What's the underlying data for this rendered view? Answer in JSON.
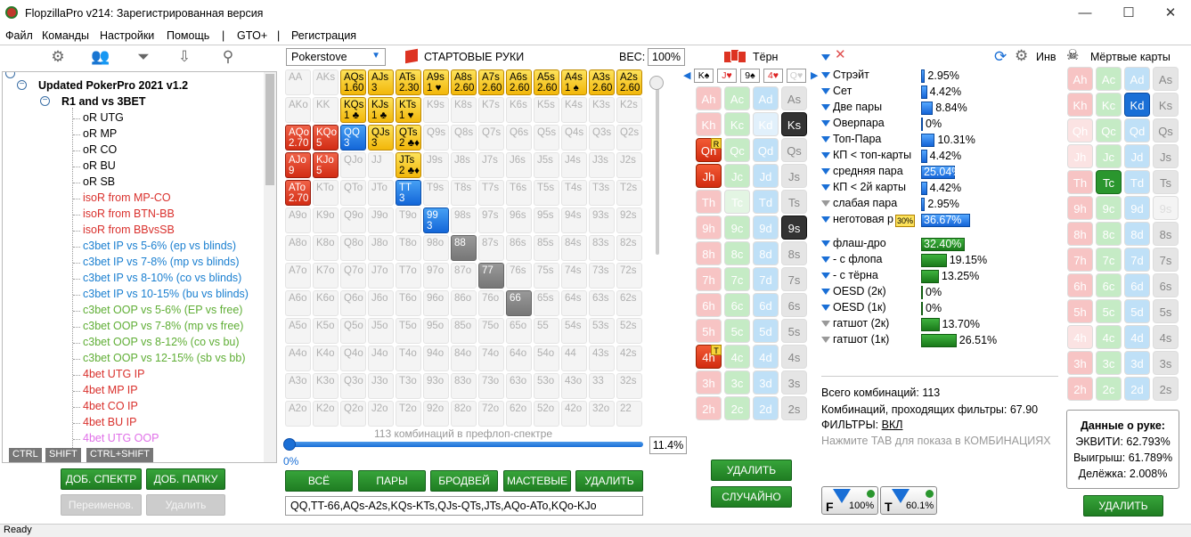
{
  "window": {
    "title": "FlopzillaPro v214: Зарегистрированная версия",
    "minimize": "—",
    "maximize": "☐",
    "close": "✕"
  },
  "menu": [
    "Файл",
    "Команды",
    "Настройки",
    "Помощь",
    "|",
    "GTO+",
    "|",
    "Регистрация"
  ],
  "tree": {
    "root": "Updated PokerPro 2021 v1.2",
    "folder": "R1 and vs 3BET",
    "items": [
      {
        "label": "oR UTG",
        "color": "#000000"
      },
      {
        "label": "oR MP",
        "color": "#000000"
      },
      {
        "label": "oR CO",
        "color": "#000000"
      },
      {
        "label": "oR BU",
        "color": "#000000"
      },
      {
        "label": "oR SB",
        "color": "#000000"
      },
      {
        "label": "isoR from MP-CO",
        "color": "#d9302c"
      },
      {
        "label": "isoR from BTN-BB",
        "color": "#d9302c"
      },
      {
        "label": "isoR from BBvsSB",
        "color": "#d9302c"
      },
      {
        "label": "c3bet IP vs 5-6% (ep vs blinds)",
        "color": "#1a7fd0"
      },
      {
        "label": "c3bet IP vs 7-8% (mp vs blinds)",
        "color": "#1a7fd0"
      },
      {
        "label": "c3bet IP vs 8-10% (co vs blinds)",
        "color": "#1a7fd0"
      },
      {
        "label": "c3bet IP vs 10-15% (bu vs blinds)",
        "color": "#1a7fd0"
      },
      {
        "label": "c3bet OOP vs 5-6% (EP vs free)",
        "color": "#5fae35"
      },
      {
        "label": "c3bet OOP vs 7-8% (mp vs free)",
        "color": "#5fae35"
      },
      {
        "label": "c3bet OOP vs 8-12% (co vs bu)",
        "color": "#5fae35"
      },
      {
        "label": "c3bet OOP vs 12-15% (sb vs bb)",
        "color": "#5fae35"
      },
      {
        "label": "4bet UTG IP",
        "color": "#d9302c"
      },
      {
        "label": "4bet MP IP",
        "color": "#d9302c"
      },
      {
        "label": "4bet CO IP",
        "color": "#d9302c"
      },
      {
        "label": "4bet BU IP",
        "color": "#d9302c"
      },
      {
        "label": "4bet UTG OOP",
        "color": "#e070e8"
      }
    ]
  },
  "keys": [
    "CTRL",
    "SHIFT",
    "CTRL+SHIFT"
  ],
  "left_buttons": {
    "add_range": "ДОБ. СПЕКТР",
    "add_folder": "ДОБ. ПАПКУ",
    "rename": "Переименов.",
    "delete": "Удалить"
  },
  "range": {
    "source": "Pokerstove",
    "header": "СТАРТОВЫЕ РУКИ",
    "weight_label": "ВЕС:",
    "weight": "100%",
    "combos_text": "113 комбинаций в префлоп-спектре",
    "slider_min": "0%",
    "slider_value": "11.4%",
    "buttons": [
      "ВСЁ",
      "ПАРЫ",
      "БРОДВЕЙ",
      "МАСТЕВЫЕ",
      "УДАЛИТЬ"
    ],
    "text": "QQ,TT-66,AQs-A2s,KQs-KTs,QJs-QTs,JTs,AQo-ATo,KQo-KJo",
    "grid": [
      [
        "AA",
        "AKs",
        "AQs",
        "AJs",
        "ATs",
        "A9s",
        "A8s",
        "A7s",
        "A6s",
        "A5s",
        "A4s",
        "A3s",
        "A2s"
      ],
      [
        "AKo",
        "KK",
        "KQs",
        "KJs",
        "KTs",
        "K9s",
        "K8s",
        "K7s",
        "K6s",
        "K5s",
        "K4s",
        "K3s",
        "K2s"
      ],
      [
        "AQo",
        "KQo",
        "QQ",
        "QJs",
        "QTs",
        "Q9s",
        "Q8s",
        "Q7s",
        "Q6s",
        "Q5s",
        "Q4s",
        "Q3s",
        "Q2s"
      ],
      [
        "AJo",
        "KJo",
        "QJo",
        "JJ",
        "JTs",
        "J9s",
        "J8s",
        "J7s",
        "J6s",
        "J5s",
        "J4s",
        "J3s",
        "J2s"
      ],
      [
        "ATo",
        "KTo",
        "QTo",
        "JTo",
        "TT",
        "T9s",
        "T8s",
        "T7s",
        "T6s",
        "T5s",
        "T4s",
        "T3s",
        "T2s"
      ],
      [
        "A9o",
        "K9o",
        "Q9o",
        "J9o",
        "T9o",
        "99",
        "98s",
        "97s",
        "96s",
        "95s",
        "94s",
        "93s",
        "92s"
      ],
      [
        "A8o",
        "K8o",
        "Q8o",
        "J8o",
        "T8o",
        "98o",
        "88",
        "87s",
        "86s",
        "85s",
        "84s",
        "83s",
        "82s"
      ],
      [
        "A7o",
        "K7o",
        "Q7o",
        "J7o",
        "T7o",
        "97o",
        "87o",
        "77",
        "76s",
        "75s",
        "74s",
        "73s",
        "72s"
      ],
      [
        "A6o",
        "K6o",
        "Q6o",
        "J6o",
        "T6o",
        "96o",
        "86o",
        "76o",
        "66",
        "65s",
        "64s",
        "63s",
        "62s"
      ],
      [
        "A5o",
        "K5o",
        "Q5o",
        "J5o",
        "T5o",
        "95o",
        "85o",
        "75o",
        "65o",
        "55",
        "54s",
        "53s",
        "52s"
      ],
      [
        "A4o",
        "K4o",
        "Q4o",
        "J4o",
        "T4o",
        "94o",
        "84o",
        "74o",
        "64o",
        "54o",
        "44",
        "43s",
        "42s"
      ],
      [
        "A3o",
        "K3o",
        "Q3o",
        "J3o",
        "T3o",
        "93o",
        "83o",
        "73o",
        "63o",
        "53o",
        "43o",
        "33",
        "32s"
      ],
      [
        "A2o",
        "K2o",
        "Q2o",
        "J2o",
        "T2o",
        "92o",
        "82o",
        "72o",
        "62o",
        "52o",
        "42o",
        "32o",
        "22"
      ]
    ],
    "active": {
      "AQs": {
        "c": "y",
        "n": "1.60"
      },
      "AJs": {
        "c": "y",
        "n": "3"
      },
      "ATs": {
        "c": "y",
        "n": "2.30"
      },
      "A9s": {
        "c": "y",
        "n": "1 ♥"
      },
      "A8s": {
        "c": "y",
        "n": "2.60"
      },
      "A7s": {
        "c": "y",
        "n": "2.60"
      },
      "A6s": {
        "c": "y",
        "n": "2.60"
      },
      "A5s": {
        "c": "y",
        "n": "2.60"
      },
      "A4s": {
        "c": "y",
        "n": "1 ♠"
      },
      "A3s": {
        "c": "y",
        "n": "2.60"
      },
      "A2s": {
        "c": "y",
        "n": "2.60"
      },
      "KQs": {
        "c": "y",
        "n": "1 ♣"
      },
      "KJs": {
        "c": "y",
        "n": "1 ♣"
      },
      "KTs": {
        "c": "y",
        "n": "1 ♥"
      },
      "AQo": {
        "c": "r",
        "n": "2.70"
      },
      "KQo": {
        "c": "r",
        "n": "5"
      },
      "QQ": {
        "c": "b",
        "n": "3"
      },
      "QJs": {
        "c": "y",
        "n": "3"
      },
      "QTs": {
        "c": "y",
        "n": "2 ♣♦"
      },
      "AJo": {
        "c": "r",
        "n": "9"
      },
      "KJo": {
        "c": "r",
        "n": "5"
      },
      "JTs": {
        "c": "y",
        "n": "2 ♣♦"
      },
      "ATo": {
        "c": "r",
        "n": "2.70"
      },
      "TT": {
        "c": "b",
        "n": "3"
      },
      "99": {
        "c": "b",
        "n": "3"
      },
      "88": {
        "c": "g",
        "n": ""
      },
      "77": {
        "c": "g",
        "n": ""
      },
      "66": {
        "c": "g",
        "n": ""
      }
    }
  },
  "turn": {
    "title": "Тёрн",
    "board": [
      "K♠",
      "J♥",
      "9♠",
      "4♥",
      "Q♥"
    ],
    "delete": "УДАЛИТЬ",
    "random": "СЛУЧАЙНО",
    "rows": [
      [
        {
          "t": "Ah",
          "s": "h"
        },
        {
          "t": "Ac",
          "s": "c"
        },
        {
          "t": "Ad",
          "s": "d"
        },
        {
          "t": "As",
          "s": "s"
        }
      ],
      [
        {
          "t": "Kh",
          "s": "h"
        },
        {
          "t": "Kc",
          "s": "c"
        },
        {
          "t": "Kd",
          "s": "dd"
        },
        {
          "t": "Ks",
          "s": "sel-s"
        }
      ],
      [
        {
          "t": "Qh",
          "s": "sel-h",
          "b": "R"
        },
        {
          "t": "Qc",
          "s": "c"
        },
        {
          "t": "Qd",
          "s": "d"
        },
        {
          "t": "Qs",
          "s": "s"
        }
      ],
      [
        {
          "t": "Jh",
          "s": "sel-h"
        },
        {
          "t": "Jc",
          "s": "c"
        },
        {
          "t": "Jd",
          "s": "d"
        },
        {
          "t": "Js",
          "s": "s"
        }
      ],
      [
        {
          "t": "Th",
          "s": "h"
        },
        {
          "t": "Tc",
          "s": "cd"
        },
        {
          "t": "Td",
          "s": "d"
        },
        {
          "t": "Ts",
          "s": "s"
        }
      ],
      [
        {
          "t": "9h",
          "s": "h"
        },
        {
          "t": "9c",
          "s": "c"
        },
        {
          "t": "9d",
          "s": "d"
        },
        {
          "t": "9s",
          "s": "sel-s"
        }
      ],
      [
        {
          "t": "8h",
          "s": "h"
        },
        {
          "t": "8c",
          "s": "c"
        },
        {
          "t": "8d",
          "s": "d"
        },
        {
          "t": "8s",
          "s": "s"
        }
      ],
      [
        {
          "t": "7h",
          "s": "h"
        },
        {
          "t": "7c",
          "s": "c"
        },
        {
          "t": "7d",
          "s": "d"
        },
        {
          "t": "7s",
          "s": "s"
        }
      ],
      [
        {
          "t": "6h",
          "s": "h"
        },
        {
          "t": "6c",
          "s": "c"
        },
        {
          "t": "6d",
          "s": "d"
        },
        {
          "t": "6s",
          "s": "s"
        }
      ],
      [
        {
          "t": "5h",
          "s": "h"
        },
        {
          "t": "5c",
          "s": "c"
        },
        {
          "t": "5d",
          "s": "d"
        },
        {
          "t": "5s",
          "s": "s"
        }
      ],
      [
        {
          "t": "4h",
          "s": "sel-h",
          "b": "T"
        },
        {
          "t": "4c",
          "s": "c"
        },
        {
          "t": "4d",
          "s": "d"
        },
        {
          "t": "4s",
          "s": "s"
        }
      ],
      [
        {
          "t": "3h",
          "s": "h"
        },
        {
          "t": "3c",
          "s": "c"
        },
        {
          "t": "3d",
          "s": "d"
        },
        {
          "t": "3s",
          "s": "s"
        }
      ],
      [
        {
          "t": "2h",
          "s": "h"
        },
        {
          "t": "2c",
          "s": "c"
        },
        {
          "t": "2d",
          "s": "d"
        },
        {
          "t": "2s",
          "s": "s"
        }
      ]
    ]
  },
  "hands": {
    "made": [
      {
        "label": "Стрэйт",
        "pct": "2.95%",
        "v": 2.95,
        "f": "blue"
      },
      {
        "label": "Сет",
        "pct": "4.42%",
        "v": 4.42,
        "f": "blue"
      },
      {
        "label": "Две пары",
        "pct": "8.84%",
        "v": 8.84,
        "f": "blue"
      },
      {
        "label": "Оверпара",
        "pct": "0%",
        "v": 0,
        "f": "blue"
      },
      {
        "label": "Топ-Пара",
        "pct": "10.31%",
        "v": 10.31,
        "f": "blue"
      },
      {
        "label": "КП < топ-карты",
        "pct": "4.42%",
        "v": 4.42,
        "f": "blue"
      },
      {
        "label": "средняя пара",
        "pct": "25.04%",
        "v": 25.04,
        "f": "blue"
      },
      {
        "label": "КП < 2й карты",
        "pct": "4.42%",
        "v": 4.42,
        "f": "blue"
      },
      {
        "label": "слабая пара",
        "pct": "2.95%",
        "v": 2.95,
        "f": "grey"
      },
      {
        "label": "неготовая р",
        "pct": "36.67%",
        "v": 36.67,
        "f": "blue",
        "tag": "30%"
      }
    ],
    "draws": [
      {
        "label": "флаш-дро",
        "pct": "32.40%",
        "v": 32.4,
        "f": "blue"
      },
      {
        "label": "- с флопа",
        "pct": "19.15%",
        "v": 19.15,
        "f": "blue"
      },
      {
        "label": "- с тёрна",
        "pct": "13.25%",
        "v": 13.25,
        "f": "blue"
      },
      {
        "label": "OESD (2к)",
        "pct": "0%",
        "v": 0,
        "f": "blue"
      },
      {
        "label": "OESD (1к)",
        "pct": "0%",
        "v": 0,
        "f": "blue"
      },
      {
        "label": "гатшот (2к)",
        "pct": "13.70%",
        "v": 13.7,
        "f": "grey"
      },
      {
        "label": "гатшот (1к)",
        "pct": "26.51%",
        "v": 26.51,
        "f": "grey"
      }
    ],
    "total": "Всего комбинаций: 113",
    "passing": "Комбинаций, проходящих фильтры: 67.90",
    "filters_label": "ФИЛЬТРЫ:",
    "filters_value": "ВКЛ",
    "tab_hint": "Нажмите TAB для показа в КОМБИНАЦИЯХ",
    "inv": "Инв",
    "f_badge": "F",
    "f_value": "100%",
    "t_badge": "T",
    "t_value": "60.1%"
  },
  "dead": {
    "title": "Мёртвые карты",
    "delete": "УДАЛИТЬ",
    "rows": [
      [
        {
          "t": "Ah",
          "s": "h"
        },
        {
          "t": "Ac",
          "s": "c"
        },
        {
          "t": "Ad",
          "s": "d"
        },
        {
          "t": "As",
          "s": "s"
        }
      ],
      [
        {
          "t": "Kh",
          "s": "h"
        },
        {
          "t": "Kc",
          "s": "c"
        },
        {
          "t": "Kd",
          "s": "sel-d"
        },
        {
          "t": "Ks",
          "s": "s"
        }
      ],
      [
        {
          "t": "Qh",
          "s": "hd"
        },
        {
          "t": "Qc",
          "s": "c"
        },
        {
          "t": "Qd",
          "s": "d"
        },
        {
          "t": "Qs",
          "s": "s"
        }
      ],
      [
        {
          "t": "Jh",
          "s": "hd"
        },
        {
          "t": "Jc",
          "s": "c"
        },
        {
          "t": "Jd",
          "s": "d"
        },
        {
          "t": "Js",
          "s": "s"
        }
      ],
      [
        {
          "t": "Th",
          "s": "h"
        },
        {
          "t": "Tc",
          "s": "sel-c"
        },
        {
          "t": "Td",
          "s": "d"
        },
        {
          "t": "Ts",
          "s": "s"
        }
      ],
      [
        {
          "t": "9h",
          "s": "h"
        },
        {
          "t": "9c",
          "s": "c"
        },
        {
          "t": "9d",
          "s": "d"
        },
        {
          "t": "9s",
          "s": "sd"
        }
      ],
      [
        {
          "t": "8h",
          "s": "h"
        },
        {
          "t": "8c",
          "s": "c"
        },
        {
          "t": "8d",
          "s": "d"
        },
        {
          "t": "8s",
          "s": "s"
        }
      ],
      [
        {
          "t": "7h",
          "s": "h"
        },
        {
          "t": "7c",
          "s": "c"
        },
        {
          "t": "7d",
          "s": "d"
        },
        {
          "t": "7s",
          "s": "s"
        }
      ],
      [
        {
          "t": "6h",
          "s": "h"
        },
        {
          "t": "6c",
          "s": "c"
        },
        {
          "t": "6d",
          "s": "d"
        },
        {
          "t": "6s",
          "s": "s"
        }
      ],
      [
        {
          "t": "5h",
          "s": "h"
        },
        {
          "t": "5c",
          "s": "c"
        },
        {
          "t": "5d",
          "s": "d"
        },
        {
          "t": "5s",
          "s": "s"
        }
      ],
      [
        {
          "t": "4h",
          "s": "hd"
        },
        {
          "t": "4c",
          "s": "c"
        },
        {
          "t": "4d",
          "s": "d"
        },
        {
          "t": "4s",
          "s": "s"
        }
      ],
      [
        {
          "t": "3h",
          "s": "h"
        },
        {
          "t": "3c",
          "s": "c"
        },
        {
          "t": "3d",
          "s": "d"
        },
        {
          "t": "3s",
          "s": "s"
        }
      ],
      [
        {
          "t": "2h",
          "s": "h"
        },
        {
          "t": "2c",
          "s": "c"
        },
        {
          "t": "2d",
          "s": "d"
        },
        {
          "t": "2s",
          "s": "s"
        }
      ]
    ],
    "equity": {
      "title": "Данные о руке:",
      "equity": "ЭКВИТИ: 62.793%",
      "win": "Выигрыш: 61.789%",
      "tie": "Делёжка: 2.008%"
    }
  },
  "status": "Ready"
}
